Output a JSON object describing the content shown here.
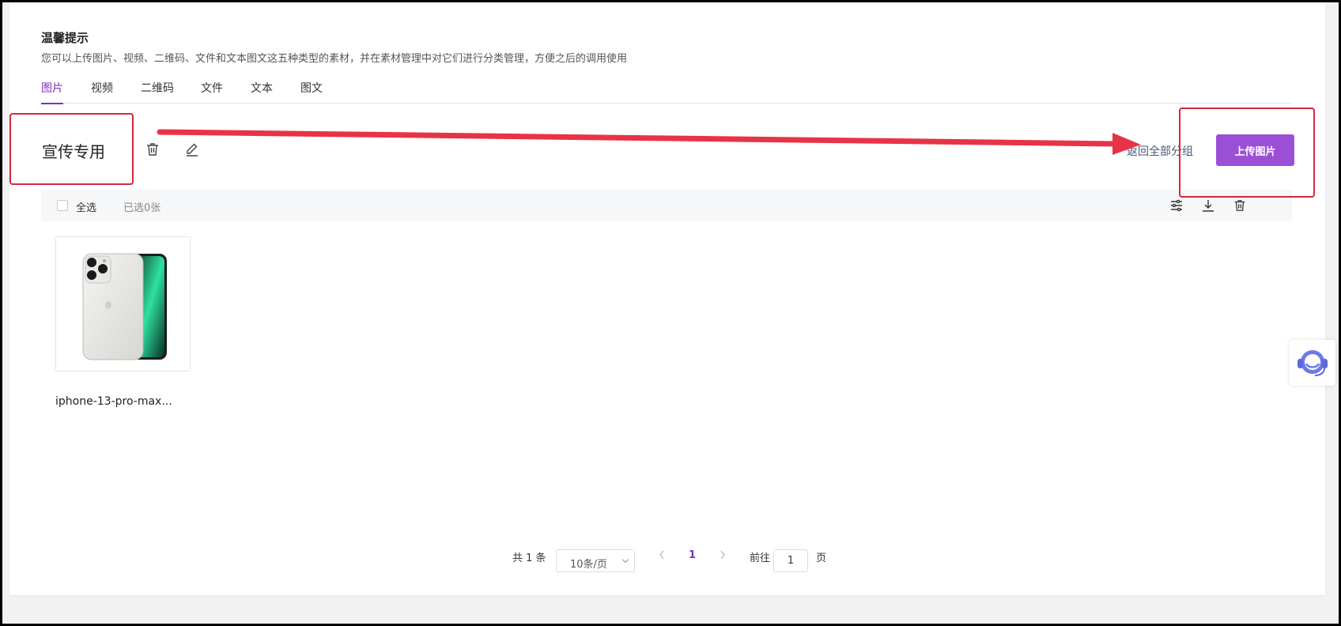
{
  "tip": {
    "title": "温馨提示",
    "description": "您可以上传图片、视频、二维码、文件和文本图文这五种类型的素材，并在素材管理中对它们进行分类管理，方便之后的调用使用"
  },
  "tabs": [
    {
      "label": "图片",
      "active": true
    },
    {
      "label": "视频",
      "active": false
    },
    {
      "label": "二维码",
      "active": false
    },
    {
      "label": "文件",
      "active": false
    },
    {
      "label": "文本",
      "active": false
    },
    {
      "label": "图文",
      "active": false
    }
  ],
  "group": {
    "name": "宣传专用",
    "back_label": "返回全部分组",
    "upload_label": "上传图片"
  },
  "toolbar": {
    "select_all": "全选",
    "selected_count": "已选0张"
  },
  "items": [
    {
      "caption": "iphone-13-pro-max..."
    }
  ],
  "pagination": {
    "total_label": "共 1 条",
    "page_size": "10条/页",
    "current_page": "1",
    "goto_prefix": "前往",
    "goto_value": "1",
    "goto_suffix": "页"
  },
  "colors": {
    "accent": "#9b4fd6",
    "tab_active": "#7c2fc6",
    "annotation": "#d9263c"
  },
  "icons": {
    "group_delete": "trash-icon",
    "group_edit": "edit-icon",
    "toolbar_filter": "sliders-icon",
    "toolbar_download": "download-icon",
    "toolbar_delete": "trash-icon",
    "service": "customer-service-icon"
  }
}
